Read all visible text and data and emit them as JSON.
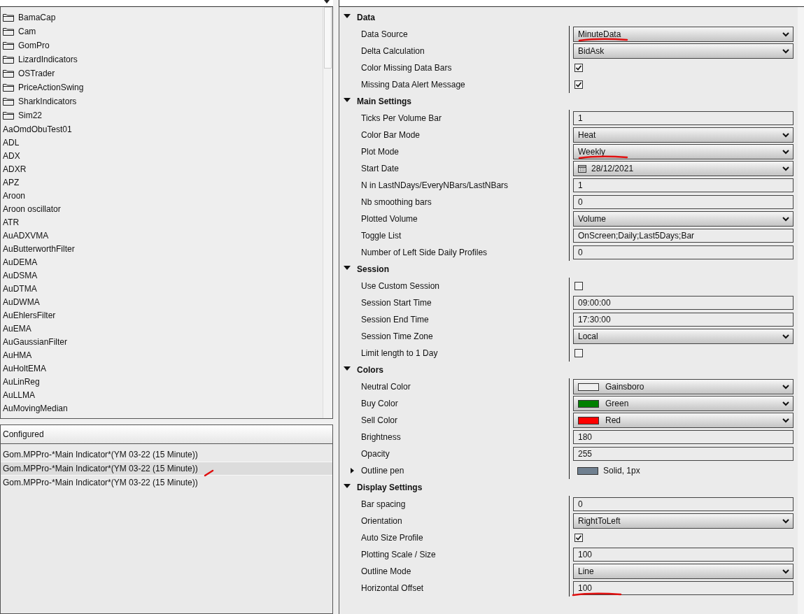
{
  "indicator_tree": [
    {
      "kind": "folder",
      "label": "BamaCap"
    },
    {
      "kind": "folder",
      "label": "Cam"
    },
    {
      "kind": "folder",
      "label": "GomPro"
    },
    {
      "kind": "folder",
      "label": "LizardIndicators"
    },
    {
      "kind": "folder",
      "label": "OSTrader"
    },
    {
      "kind": "folder",
      "label": "PriceActionSwing"
    },
    {
      "kind": "folder",
      "label": "SharkIndicators"
    },
    {
      "kind": "folder",
      "label": "Sim22"
    },
    {
      "kind": "item",
      "label": "AaOmdObuTest01"
    },
    {
      "kind": "item",
      "label": "ADL"
    },
    {
      "kind": "item",
      "label": "ADX"
    },
    {
      "kind": "item",
      "label": "ADXR"
    },
    {
      "kind": "item",
      "label": "APZ"
    },
    {
      "kind": "item",
      "label": "Aroon"
    },
    {
      "kind": "item",
      "label": "Aroon oscillator"
    },
    {
      "kind": "item",
      "label": "ATR"
    },
    {
      "kind": "item",
      "label": "AuADXVMA"
    },
    {
      "kind": "item",
      "label": "AuButterworthFilter"
    },
    {
      "kind": "item",
      "label": "AuDEMA"
    },
    {
      "kind": "item",
      "label": "AuDSMA"
    },
    {
      "kind": "item",
      "label": "AuDTMA"
    },
    {
      "kind": "item",
      "label": "AuDWMA"
    },
    {
      "kind": "item",
      "label": "AuEhlersFilter"
    },
    {
      "kind": "item",
      "label": "AuEMA"
    },
    {
      "kind": "item",
      "label": "AuGaussianFilter"
    },
    {
      "kind": "item",
      "label": "AuHMA"
    },
    {
      "kind": "item",
      "label": "AuHoltEMA"
    },
    {
      "kind": "item",
      "label": "AuLinReg"
    },
    {
      "kind": "item",
      "label": "AuLLMA"
    },
    {
      "kind": "item",
      "label": "AuMovingMedian"
    }
  ],
  "configured": {
    "title": "Configured",
    "items": [
      {
        "label": "Gom.MPPro-*Main Indicator*(YM 03-22 (15 Minute))",
        "selected": false,
        "marked": false
      },
      {
        "label": "Gom.MPPro-*Main Indicator*(YM 03-22 (15 Minute))",
        "selected": true,
        "marked": true
      },
      {
        "label": "Gom.MPPro-*Main Indicator*(YM 03-22 (15 Minute))",
        "selected": false,
        "marked": false
      }
    ]
  },
  "properties": [
    {
      "title": "Data",
      "expanded": true,
      "rows": [
        {
          "kind": "dropdown",
          "label": "Data Source",
          "value": "MinuteData",
          "marked": true
        },
        {
          "kind": "dropdown",
          "label": "Delta Calculation",
          "value": "BidAsk",
          "marked": false
        },
        {
          "kind": "checkbox",
          "label": "Color Missing Data Bars",
          "checked": true
        },
        {
          "kind": "checkbox",
          "label": "Missing Data Alert Message",
          "checked": true
        }
      ]
    },
    {
      "title": "Main Settings",
      "expanded": true,
      "rows": [
        {
          "kind": "text",
          "label": "Ticks Per Volume Bar",
          "value": "1",
          "marked": false
        },
        {
          "kind": "dropdown",
          "label": "Color Bar Mode",
          "value": "Heat",
          "marked": false
        },
        {
          "kind": "dropdown",
          "label": "Plot Mode",
          "value": "Weekly",
          "marked": true
        },
        {
          "kind": "date",
          "label": "Start Date",
          "value": "28/12/2021"
        },
        {
          "kind": "text",
          "label": "N in LastNDays/EveryNBars/LastNBars",
          "value": "1",
          "marked": false
        },
        {
          "kind": "text",
          "label": "Nb smoothing bars",
          "value": "0",
          "marked": false
        },
        {
          "kind": "dropdown",
          "label": "Plotted Volume",
          "value": "Volume",
          "marked": false
        },
        {
          "kind": "text",
          "label": "Toggle List",
          "value": "OnScreen;Daily;Last5Days;Bar",
          "marked": false
        },
        {
          "kind": "text",
          "label": "Number of Left Side Daily Profiles",
          "value": "0",
          "marked": false
        }
      ]
    },
    {
      "title": "Session",
      "expanded": true,
      "rows": [
        {
          "kind": "checkbox",
          "label": "Use Custom Session",
          "checked": false
        },
        {
          "kind": "text",
          "label": "Session Start Time",
          "value": "09:00:00",
          "marked": false
        },
        {
          "kind": "text",
          "label": "Session End Time",
          "value": "17:30:00",
          "marked": false
        },
        {
          "kind": "dropdown",
          "label": "Session Time Zone",
          "value": "Local",
          "marked": false
        },
        {
          "kind": "checkbox",
          "label": "Limit length to 1 Day",
          "checked": false
        }
      ]
    },
    {
      "title": "Colors",
      "expanded": true,
      "rows": [
        {
          "kind": "color",
          "label": "Neutral Color",
          "value": "Gainsboro",
          "color": "#f0f0f0"
        },
        {
          "kind": "color",
          "label": "Buy Color",
          "value": "Green",
          "color": "#008000"
        },
        {
          "kind": "color",
          "label": "Sell Color",
          "value": "Red",
          "color": "#ff0000"
        },
        {
          "kind": "text",
          "label": "Brightness",
          "value": "180",
          "marked": false
        },
        {
          "kind": "text",
          "label": "Opacity",
          "value": "255",
          "marked": false
        },
        {
          "kind": "pen",
          "label": "Outline pen",
          "value": "Solid, 1px",
          "color": "#708090",
          "expanded": false
        }
      ]
    },
    {
      "title": "Display Settings",
      "expanded": true,
      "rows": [
        {
          "kind": "text",
          "label": "Bar spacing",
          "value": "0",
          "marked": false
        },
        {
          "kind": "dropdown",
          "label": "Orientation",
          "value": "RightToLeft",
          "marked": false
        },
        {
          "kind": "checkbox",
          "label": "Auto Size Profile",
          "checked": true
        },
        {
          "kind": "text",
          "label": "Plotting Scale / Size",
          "value": "100",
          "marked": false
        },
        {
          "kind": "dropdown",
          "label": "Outline Mode",
          "value": "Line",
          "marked": false
        },
        {
          "kind": "text",
          "label": "Horizontal Offset",
          "value": "100",
          "marked": true
        }
      ]
    }
  ]
}
